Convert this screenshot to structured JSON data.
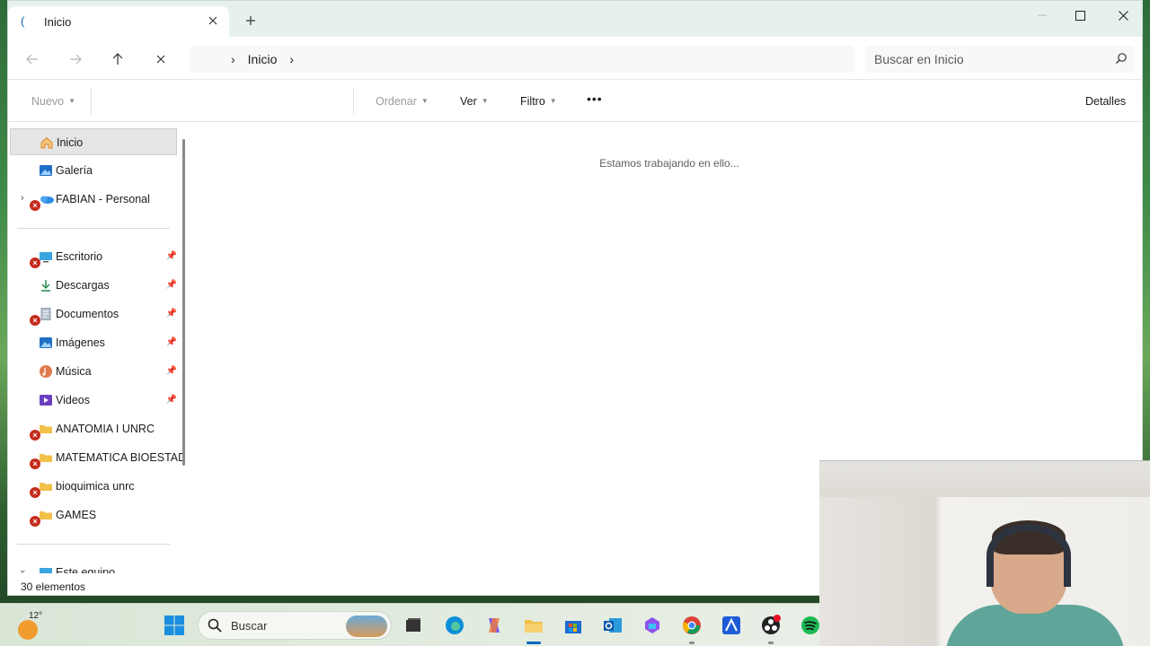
{
  "window": {
    "tab_title": "Inicio",
    "new_tab": "+"
  },
  "nav": {
    "breadcrumb": "Inicio",
    "search_placeholder": "Buscar en Inicio"
  },
  "commands": {
    "new": "Nuevo",
    "sort": "Ordenar",
    "view": "Ver",
    "filter": "Filtro",
    "more": "•••",
    "details": "Detalles"
  },
  "sidebar": {
    "items": [
      {
        "label": "Inicio",
        "icon": "home-icon"
      },
      {
        "label": "Galería",
        "icon": "gallery-icon"
      },
      {
        "label": "FABIAN - Personal",
        "icon": "onedrive-icon"
      },
      {
        "label": "Escritorio",
        "icon": "desktop-icon"
      },
      {
        "label": "Descargas",
        "icon": "download-icon"
      },
      {
        "label": "Documentos",
        "icon": "documents-icon"
      },
      {
        "label": "Imágenes",
        "icon": "pictures-icon"
      },
      {
        "label": "Música",
        "icon": "music-icon"
      },
      {
        "label": "Videos",
        "icon": "videos-icon"
      },
      {
        "label": "ANATOMIA I UNRC",
        "icon": "folder-icon"
      },
      {
        "label": "MATEMATICA BIOESTADI",
        "icon": "folder-icon"
      },
      {
        "label": "bioquimica unrc",
        "icon": "folder-icon"
      },
      {
        "label": "GAMES",
        "icon": "folder-icon"
      },
      {
        "label": "Este equipo",
        "icon": "pc-icon"
      }
    ]
  },
  "content": {
    "loading_text": "Estamos trabajando en ello..."
  },
  "status": {
    "item_count": "30 elementos"
  },
  "taskbar": {
    "temperature": "12°",
    "search_label": "Buscar"
  },
  "colors": {
    "accent": "#0067c0",
    "error": "#c42b1c",
    "folder": "#f3c04a"
  }
}
